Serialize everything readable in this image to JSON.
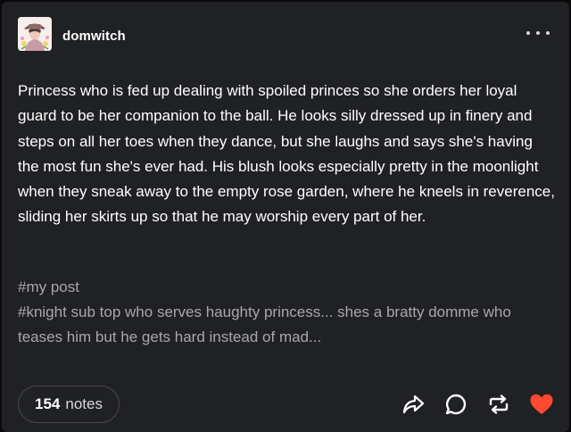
{
  "post": {
    "author": "domwitch",
    "avatar_icon": "avatar-cowboy-illustration",
    "body": "Princess who is fed up dealing with spoiled princes so she orders her loyal guard to be her companion to the ball. He looks silly dressed up in finery and steps on all her toes when they dance, but she laughs and says she's having the most fun she's ever had. His blush looks especially pretty in the moonlight when they sneak away to the empty rose garden, where he kneels in reverence, sliding her skirts up so that he may worship every part of her.",
    "tags": [
      "#my post",
      "#knight sub top who serves haughty princess... shes a bratty domme who teases him but he gets hard instead of mad..."
    ]
  },
  "footer": {
    "notes_count": "154",
    "notes_label": "notes",
    "actions": [
      "share-icon",
      "reply-icon",
      "reblog-icon",
      "like-heart-icon"
    ]
  },
  "colors": {
    "background": "#202124",
    "text": "#ffffff",
    "tags": "#a8a8a8",
    "heart": "#ff4930"
  }
}
